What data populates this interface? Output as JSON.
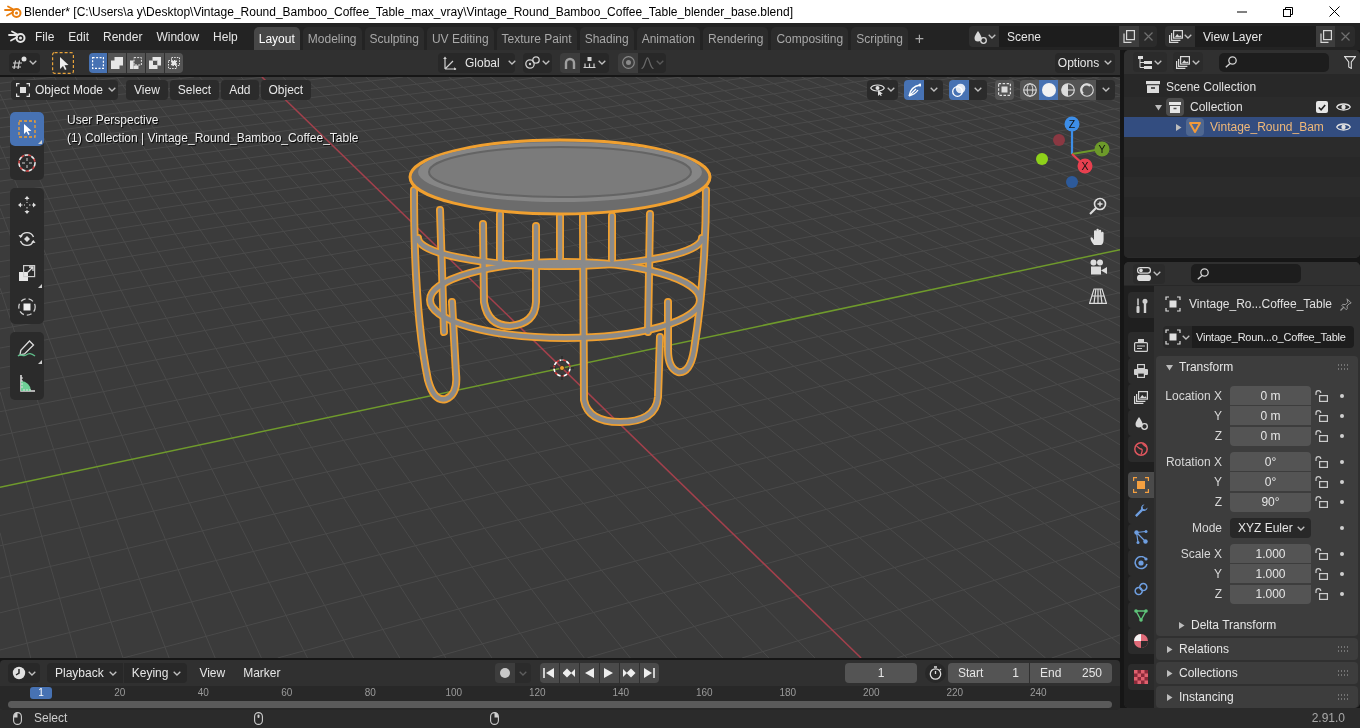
{
  "window": {
    "title": "Blender* [C:\\Users\\a y\\Desktop\\Vintage_Round_Bamboo_Coffee_Table_max_vray\\Vintage_Round_Bamboo_Coffee_Table_blender_base.blend]"
  },
  "topbar": {
    "menus": [
      "File",
      "Edit",
      "Render",
      "Window",
      "Help"
    ],
    "workspaces": [
      {
        "label": "Layout",
        "selected": true
      },
      {
        "label": "Modeling",
        "selected": false
      },
      {
        "label": "Sculpting",
        "selected": false
      },
      {
        "label": "UV Editing",
        "selected": false
      },
      {
        "label": "Texture Paint",
        "selected": false
      },
      {
        "label": "Shading",
        "selected": false
      },
      {
        "label": "Animation",
        "selected": false
      },
      {
        "label": "Rendering",
        "selected": false
      },
      {
        "label": "Compositing",
        "selected": false
      },
      {
        "label": "Scripting",
        "selected": false
      }
    ],
    "add_workspace": "+",
    "scene": "Scene",
    "view_layer": "View Layer"
  },
  "tool_settings": {
    "select_modes": [
      {
        "selected": true
      },
      {
        "selected": false
      },
      {
        "selected": false
      },
      {
        "selected": false
      },
      {
        "selected": false
      }
    ],
    "orientation": "Global",
    "snapping": {
      "on": false
    },
    "proportional_editing": {
      "on": false
    },
    "options": "Options"
  },
  "viewport": {
    "mode": "Object Mode",
    "menus": [
      "View",
      "Select",
      "Add",
      "Object"
    ],
    "gizmos": {
      "on": true
    },
    "overlays": {
      "on": true
    },
    "xray": {
      "on": false
    },
    "shading": [
      {
        "selected": false
      },
      {
        "selected": true
      },
      {
        "selected": false
      },
      {
        "selected": false
      }
    ],
    "tools": [
      {
        "selected": true
      },
      {
        "selected": false
      },
      {
        "selected": false
      },
      {
        "selected": false
      },
      {
        "selected": false
      },
      {
        "selected": false
      },
      {
        "selected": false
      },
      {
        "selected": false
      }
    ],
    "info": [
      "User Perspective",
      "(1) Collection | Vintage_Round_Bamboo_Coffee_Table"
    ],
    "axes": [
      {
        "kind": "positive",
        "label": "Z",
        "color": "#3d8ee8"
      },
      {
        "kind": "positive",
        "label": "Y",
        "color": "#6d9a2a"
      },
      {
        "kind": "positive",
        "label": "X",
        "color": "#e8404f"
      },
      {
        "kind": "negative",
        "color": "#8a3842"
      },
      {
        "kind": "negative",
        "color": "#8ed11a"
      },
      {
        "kind": "negative",
        "color": "#2d5a9a"
      }
    ]
  },
  "outliner": {
    "tree": [
      {
        "kind": "scene_collection",
        "label": "Scene Collection",
        "selected": false,
        "children": [
          {
            "kind": "collection",
            "label": "Collection",
            "selected": false,
            "expanded": true,
            "checked": true,
            "visible": true,
            "children": [
              {
                "kind": "mesh_object",
                "label": "Vintage_Round_Bam",
                "selected": true,
                "expanded": false,
                "visible": true
              }
            ]
          }
        ]
      }
    ]
  },
  "properties": {
    "tabs": [
      {
        "selected": false
      },
      {
        "selected": false
      },
      {
        "selected": false
      },
      {
        "selected": false
      },
      {
        "selected": false
      },
      {
        "selected": false
      },
      {
        "selected": true
      },
      {
        "selected": false
      },
      {
        "selected": false
      },
      {
        "selected": false
      },
      {
        "selected": false
      },
      {
        "selected": false
      },
      {
        "selected": false
      },
      {
        "selected": false
      }
    ],
    "object_name": "Vintage_Ro...Coffee_Table",
    "data_name": "Vintage_Roun...o_Coffee_Table",
    "panels": [
      {
        "title": "Transform",
        "expanded": true,
        "groups": [
          {
            "kind": "vector",
            "rows": [
              {
                "label": "Location X",
                "value": "0 m",
                "locked": false
              },
              {
                "label": "Y",
                "value": "0 m",
                "locked": false
              },
              {
                "label": "Z",
                "value": "0 m",
                "locked": false
              }
            ]
          },
          {
            "kind": "vector",
            "rows": [
              {
                "label": "Rotation X",
                "value": "0°",
                "locked": false
              },
              {
                "label": "Y",
                "value": "0°",
                "locked": false
              },
              {
                "label": "Z",
                "value": "90°",
                "locked": false
              }
            ]
          },
          {
            "kind": "dropdown",
            "label": "Mode",
            "value": "XYZ Euler"
          },
          {
            "kind": "vector",
            "rows": [
              {
                "label": "Scale X",
                "value": "1.000",
                "locked": false
              },
              {
                "label": "Y",
                "value": "1.000",
                "locked": false
              },
              {
                "label": "Z",
                "value": "1.000",
                "locked": false
              }
            ]
          }
        ],
        "subpanels": [
          {
            "title": "Delta Transform",
            "expanded": false
          }
        ]
      },
      {
        "title": "Relations",
        "expanded": false
      },
      {
        "title": "Collections",
        "expanded": false
      },
      {
        "title": "Instancing",
        "expanded": false
      }
    ]
  },
  "timeline": {
    "menus": [
      {
        "label": "Playback",
        "kind": "dropdown"
      },
      {
        "label": "Keying",
        "kind": "dropdown"
      },
      {
        "label": "View",
        "kind": "menu"
      },
      {
        "label": "Marker",
        "kind": "menu"
      }
    ],
    "auto_keying": {
      "on": false
    },
    "current_frame": "1",
    "range": [
      {
        "label": "Start",
        "value": "1"
      },
      {
        "label": "End",
        "value": "250"
      }
    ],
    "playhead": "1",
    "ruler": [
      "20",
      "40",
      "60",
      "80",
      "100",
      "120",
      "140",
      "160",
      "180",
      "200",
      "220",
      "240"
    ]
  },
  "status_bar": {
    "hints": [
      "Select"
    ],
    "version": "2.91.0"
  }
}
